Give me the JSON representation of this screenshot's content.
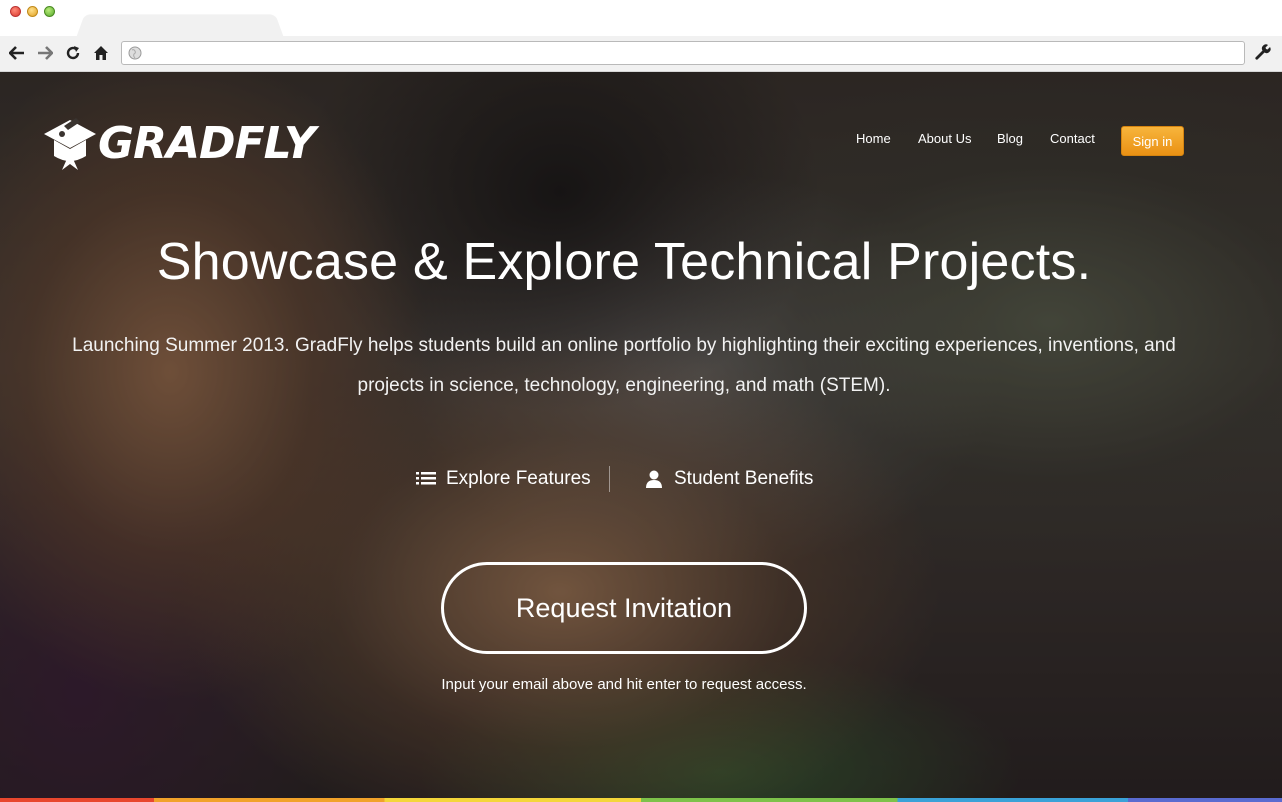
{
  "browser": {
    "url": ""
  },
  "page": {
    "logo_text": "GRADFLY",
    "nav": {
      "home": "Home",
      "about": "About Us",
      "blog": "Blog",
      "contact": "Contact",
      "signin": "Sign in"
    },
    "hero": {
      "title": "Showcase & Explore Technical Projects.",
      "description": "Launching Summer 2013. GradFly helps students build an online portfolio by highlighting their exciting experiences, inventions, and projects in science, technology, engineering, and math (STEM)."
    },
    "links": {
      "features": "Explore Features",
      "benefits": "Student Benefits"
    },
    "cta": {
      "label": "Request Invitation",
      "hint": "Input your email above and hit enter to request access."
    }
  },
  "colors": {
    "signin_bg": "#f2a224",
    "text": "#ffffff"
  },
  "icons": {
    "back": "arrow-left-icon",
    "forward": "arrow-right-icon",
    "reload": "reload-icon",
    "home": "home-icon",
    "globe": "globe-icon",
    "wrench": "wrench-icon",
    "features": "list-icon",
    "benefits": "user-icon"
  }
}
